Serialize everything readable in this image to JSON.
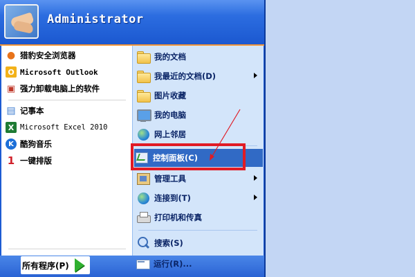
{
  "user": {
    "name": "Administrator"
  },
  "pinned": [
    {
      "label": "猎豹安全浏览器",
      "icon": "cheetah-browser-icon",
      "glyph": "●",
      "color": "#e8731a"
    },
    {
      "label": "Microsoft Outlook",
      "icon": "outlook-icon",
      "glyph": "O",
      "color": "#d98a00"
    },
    {
      "label": "强力卸载电脑上的软件",
      "icon": "uninstall-icon",
      "glyph": "▣",
      "color": "#c0392b"
    }
  ],
  "recent": [
    {
      "label": "记事本",
      "icon": "notepad-icon",
      "glyph": "▤",
      "color": "#3b7bd0"
    },
    {
      "label": "Microsoft Excel 2010",
      "icon": "excel-icon",
      "glyph": "X",
      "color": "#1e7b34"
    },
    {
      "label": "酷狗音乐",
      "icon": "kugou-icon",
      "glyph": "K",
      "color": "#1c6fd8"
    },
    {
      "label": "一键排版",
      "icon": "one-key-layout-icon",
      "glyph": "1",
      "color": "#d0202a"
    }
  ],
  "all_programs": {
    "label": "所有程序(P)"
  },
  "places": [
    {
      "label": "我的文档"
    },
    {
      "label": "我最近的文档(D)"
    },
    {
      "label": "图片收藏"
    },
    {
      "label": "我的电脑"
    },
    {
      "label": "网上邻居"
    },
    {
      "label": "控制面板(C)"
    },
    {
      "label": "管理工具"
    },
    {
      "label": "连接到(T)"
    },
    {
      "label": "打印机和传真"
    },
    {
      "label": "搜索(S)"
    },
    {
      "label": "运行(R)..."
    }
  ],
  "colors": {
    "highlight": "#316ac5",
    "annotation": "#e01b24"
  }
}
